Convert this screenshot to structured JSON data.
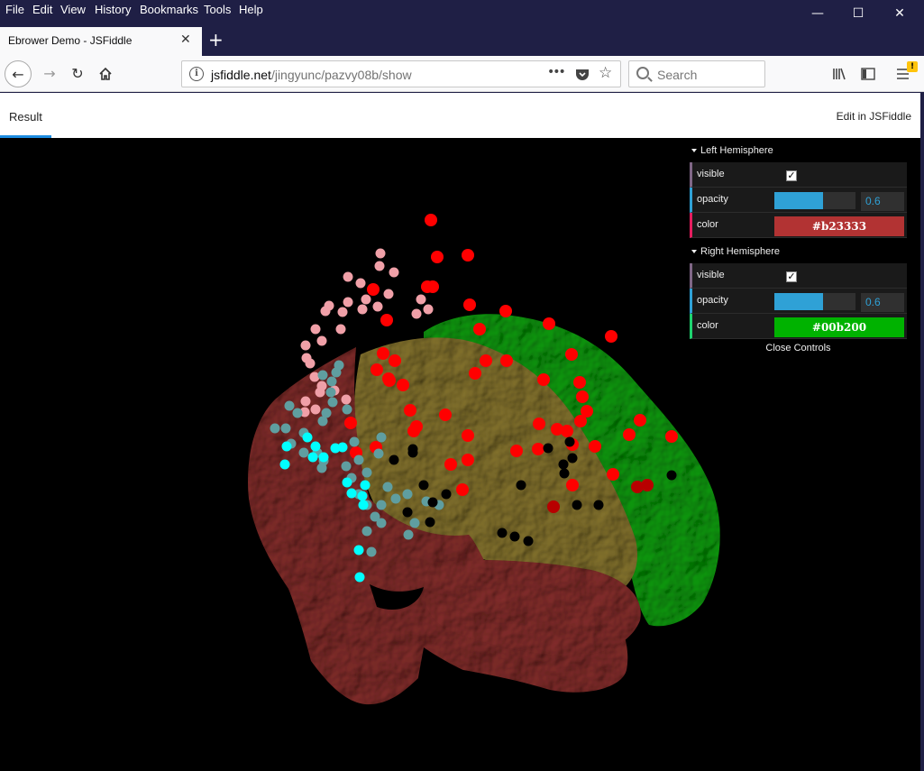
{
  "menubar": {
    "items": [
      "File",
      "Edit",
      "View",
      "History",
      "Bookmarks",
      "Tools",
      "Help"
    ]
  },
  "window_controls": {
    "minimize": "—",
    "maximize": "☐",
    "close": "✕"
  },
  "tab": {
    "title": "Ebrower Demo - JSFiddle",
    "close": "✕",
    "new_tab": "+"
  },
  "urlbar": {
    "host": "jsfiddle.net",
    "path": "/jingyunc/pazvy08b/show",
    "info": "i",
    "more": "•••"
  },
  "search": {
    "placeholder": "Search"
  },
  "jsfiddle": {
    "result_tab": "Result",
    "edit_link": "Edit in JSFiddle"
  },
  "gui": {
    "left": {
      "title": "Left Hemisphere",
      "visible_label": "visible",
      "visible": true,
      "opacity_label": "opacity",
      "opacity": "0.6",
      "opacity_fraction": 0.6,
      "color_label": "color",
      "color": "#b23333"
    },
    "right": {
      "title": "Right Hemisphere",
      "visible_label": "visible",
      "visible": true,
      "opacity_label": "opacity",
      "opacity": "0.6",
      "opacity_fraction": 0.6,
      "color_label": "color",
      "color": "#00b200"
    },
    "close_label": "Close Controls"
  },
  "scene": {
    "left_hemisphere_color": "#b23333",
    "right_hemisphere_color": "#00b200",
    "electrode_colors": [
      "#ff0000",
      "#f0a0a8",
      "#5f9ea0",
      "#00ffff",
      "#000000"
    ]
  }
}
